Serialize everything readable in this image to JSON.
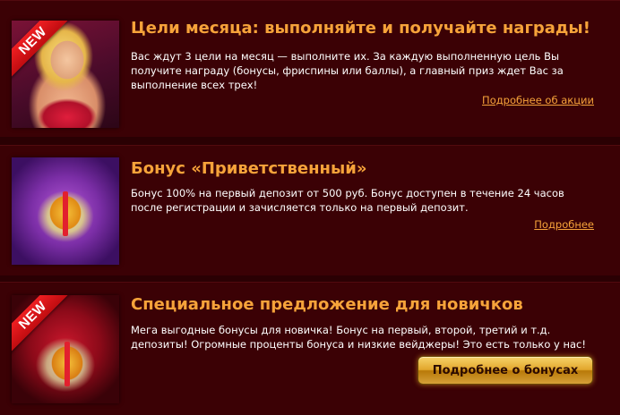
{
  "cards": [
    {
      "badge": "NEW",
      "title": "Цели месяца: выполняйте и получайте награды!",
      "description": "Вас ждут 3 цели на месяц — выполните их. За каждую выполненную цель Вы получите награду (бонусы, фриспины или баллы), а главный приз ждет Вас за выполнение всех трех!",
      "link": "Подробнее об акции"
    },
    {
      "title": "Бонус «Приветственный»",
      "description": "Бонус 100% на первый депозит от 500 руб. Бонус доступен в течение 24 часов после регистрации и зачисляется только на первый депозит.",
      "link": "Подробнее"
    },
    {
      "badge": "NEW",
      "title": "Специальное предложение для новичков",
      "description": "Мега выгодные бонусы для новичка! Бонус на первый, второй, третий и т.д. депозиты! Огромные проценты бонуса и низкие вейджеры! Это есть только у нас!",
      "button": "Подробнее о бонусах"
    }
  ],
  "colors": {
    "page_background": "#2a0003",
    "card_background": "#3b0105",
    "title": "#f6a33a",
    "link": "#f6a33a",
    "text": "#ffffff",
    "badge": "#e0161a",
    "button_gold": "#e2a62c"
  }
}
